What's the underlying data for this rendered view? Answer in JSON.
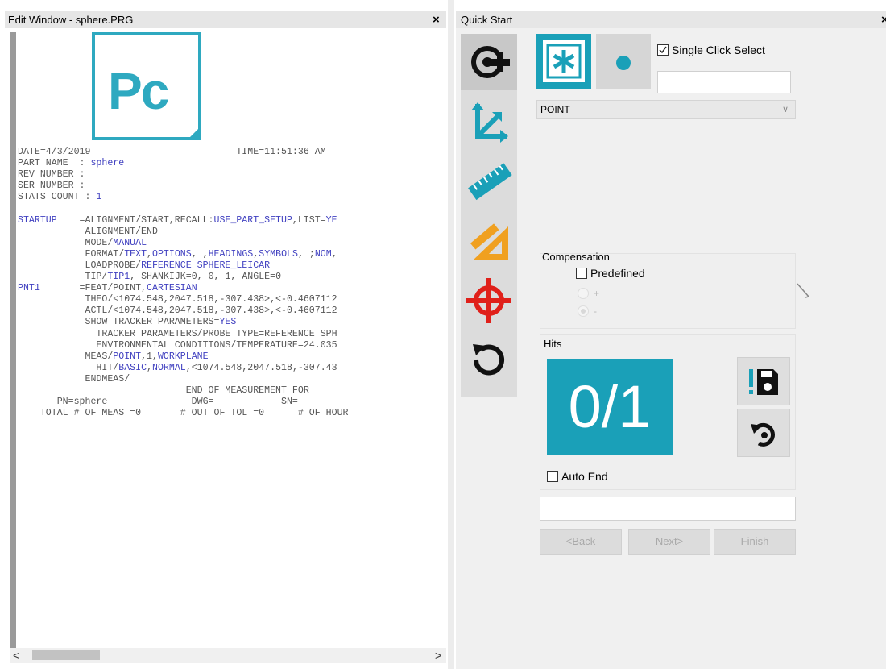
{
  "edit_window": {
    "title": "Edit Window - sphere.PRG",
    "close": "×",
    "logo_text": "Pc",
    "lines": [
      [
        {
          "t": "DATE=4/3/2019                          TIME=11:51:36 AM"
        }
      ],
      [
        {
          "t": "PART NAME  : "
        },
        {
          "t": "sphere",
          "c": "b"
        }
      ],
      [
        {
          "t": "REV NUMBER :"
        }
      ],
      [
        {
          "t": "SER NUMBER :"
        }
      ],
      [
        {
          "t": "STATS COUNT : "
        },
        {
          "t": "1",
          "c": "b"
        }
      ],
      [
        {
          "t": ""
        }
      ],
      [
        {
          "t": "STARTUP",
          "c": "b"
        },
        {
          "t": "    =ALIGNMENT/START,RECALL:"
        },
        {
          "t": "USE_PART_SETUP",
          "c": "b"
        },
        {
          "t": ",LIST="
        },
        {
          "t": "YE",
          "c": "b"
        }
      ],
      [
        {
          "t": "            ALIGNMENT/END"
        }
      ],
      [
        {
          "t": "            MODE/"
        },
        {
          "t": "MANUAL",
          "c": "b"
        }
      ],
      [
        {
          "t": "            FORMAT/"
        },
        {
          "t": "TEXT",
          "c": "b"
        },
        {
          "t": ","
        },
        {
          "t": "OPTIONS",
          "c": "b"
        },
        {
          "t": ", ,"
        },
        {
          "t": "HEADINGS",
          "c": "b"
        },
        {
          "t": ","
        },
        {
          "t": "SYMBOLS",
          "c": "b"
        },
        {
          "t": ", ;"
        },
        {
          "t": "NOM",
          "c": "b"
        },
        {
          "t": ","
        }
      ],
      [
        {
          "t": "            LOADPROBE/"
        },
        {
          "t": "REFERENCE SPHERE_LEICAR",
          "c": "b"
        }
      ],
      [
        {
          "t": "            TIP/"
        },
        {
          "t": "TIP1",
          "c": "b"
        },
        {
          "t": ", SHANKIJK=0, 0, 1, ANGLE=0"
        }
      ],
      [
        {
          "t": "PNT1",
          "c": "b"
        },
        {
          "t": "       =FEAT/POINT,"
        },
        {
          "t": "CARTESIAN",
          "c": "b"
        }
      ],
      [
        {
          "t": "            THEO/<1074.548,2047.518,-307.438>,<-0.4607112"
        }
      ],
      [
        {
          "t": "            ACTL/<1074.548,2047.518,-307.438>,<-0.4607112"
        }
      ],
      [
        {
          "t": "            SHOW TRACKER PARAMETERS="
        },
        {
          "t": "YES",
          "c": "b"
        }
      ],
      [
        {
          "t": "              TRACKER PARAMETERS/PROBE TYPE=REFERENCE SPH"
        }
      ],
      [
        {
          "t": "              ENVIRONMENTAL CONDITIONS/TEMPERATURE=24.035"
        }
      ],
      [
        {
          "t": "            MEAS/"
        },
        {
          "t": "POINT",
          "c": "b"
        },
        {
          "t": ",1,"
        },
        {
          "t": "WORKPLANE",
          "c": "b"
        }
      ],
      [
        {
          "t": "              HIT/"
        },
        {
          "t": "BASIC",
          "c": "b"
        },
        {
          "t": ","
        },
        {
          "t": "NORMAL",
          "c": "b"
        },
        {
          "t": ",<1074.548,2047.518,-307.43"
        }
      ],
      [
        {
          "t": "            ENDMEAS/"
        }
      ],
      [
        {
          "t": "                              END OF MEASUREMENT FOR"
        }
      ],
      [
        {
          "t": "       PN=sphere               DWG=            SN="
        }
      ],
      [
        {
          "t": "    TOTAL # OF MEAS =0       # OUT OF TOL =0      # OF HOUR"
        }
      ]
    ],
    "scroll_left": "<",
    "scroll_right": ">"
  },
  "quick_start": {
    "title": "Quick Start",
    "close": "×",
    "single_click_select": "Single Click Select",
    "single_click_checked": true,
    "feature_type": "POINT",
    "compensation": {
      "label": "Compensation",
      "predefined": "Predefined",
      "plus": "+",
      "minus": "-"
    },
    "hits": {
      "label": "Hits",
      "count": "0/1",
      "auto_end": "Auto End"
    },
    "nav": {
      "back": "<Back",
      "next": "Next>",
      "finish": "Finish"
    },
    "tools": [
      "probe-icon",
      "alignment-icon",
      "dimension-ruler-icon",
      "construct-icon",
      "crosshair-icon",
      "reset-icon"
    ],
    "colors": {
      "accent": "#1aa0b8",
      "orange": "#f0a020",
      "red": "#e0201a"
    }
  }
}
